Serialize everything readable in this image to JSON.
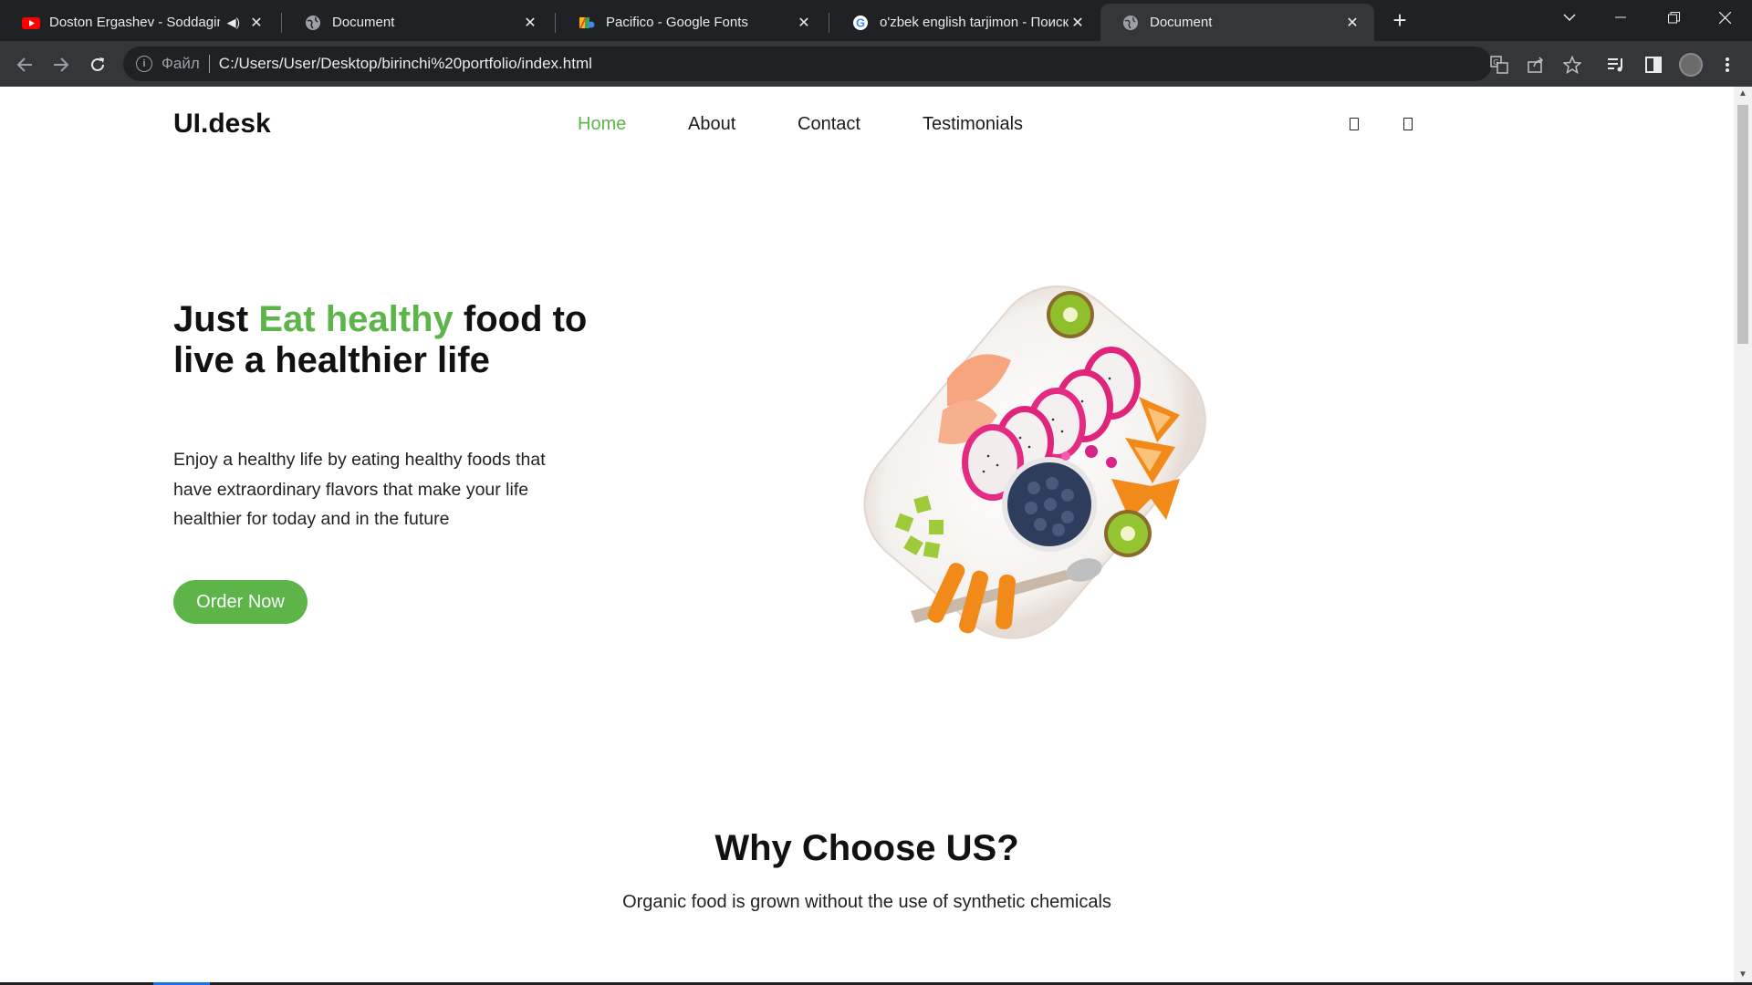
{
  "browser": {
    "tabs": [
      {
        "title": "Doston Ergashev - Soddagin",
        "favicon": "youtube-icon",
        "audio": true
      },
      {
        "title": "Document",
        "favicon": "globe-icon"
      },
      {
        "title": "Pacifico - Google Fonts",
        "favicon": "google-fonts-icon"
      },
      {
        "title": "o'zbek english tarjimon - Поиск в",
        "favicon": "google-icon"
      },
      {
        "title": "Document",
        "favicon": "globe-icon",
        "active": true
      }
    ],
    "address_scheme": "Файл",
    "address_url": "C:/Users/User/Desktop/birinchi%20portfolio/index.html",
    "accent_color": "#1a73e8"
  },
  "site": {
    "logo": "UI.desk",
    "nav": [
      {
        "label": "Home",
        "active": true
      },
      {
        "label": "About"
      },
      {
        "label": "Contact"
      },
      {
        "label": "Testimonials"
      }
    ],
    "hero": {
      "title_part1": "Just ",
      "title_accent": "Eat healthy",
      "title_part2": " food to live a healthier life",
      "text": "Enjoy a healthy life by eating healthy foods that have extraordinary flavors that make your life healthier for today and in the future",
      "button": "Order Now"
    },
    "why": {
      "title": "Why Choose US?",
      "subtitle": "Organic food is grown without the use of synthetic chemicals"
    },
    "colors": {
      "accent": "#5db54a",
      "text": "#111111"
    }
  }
}
